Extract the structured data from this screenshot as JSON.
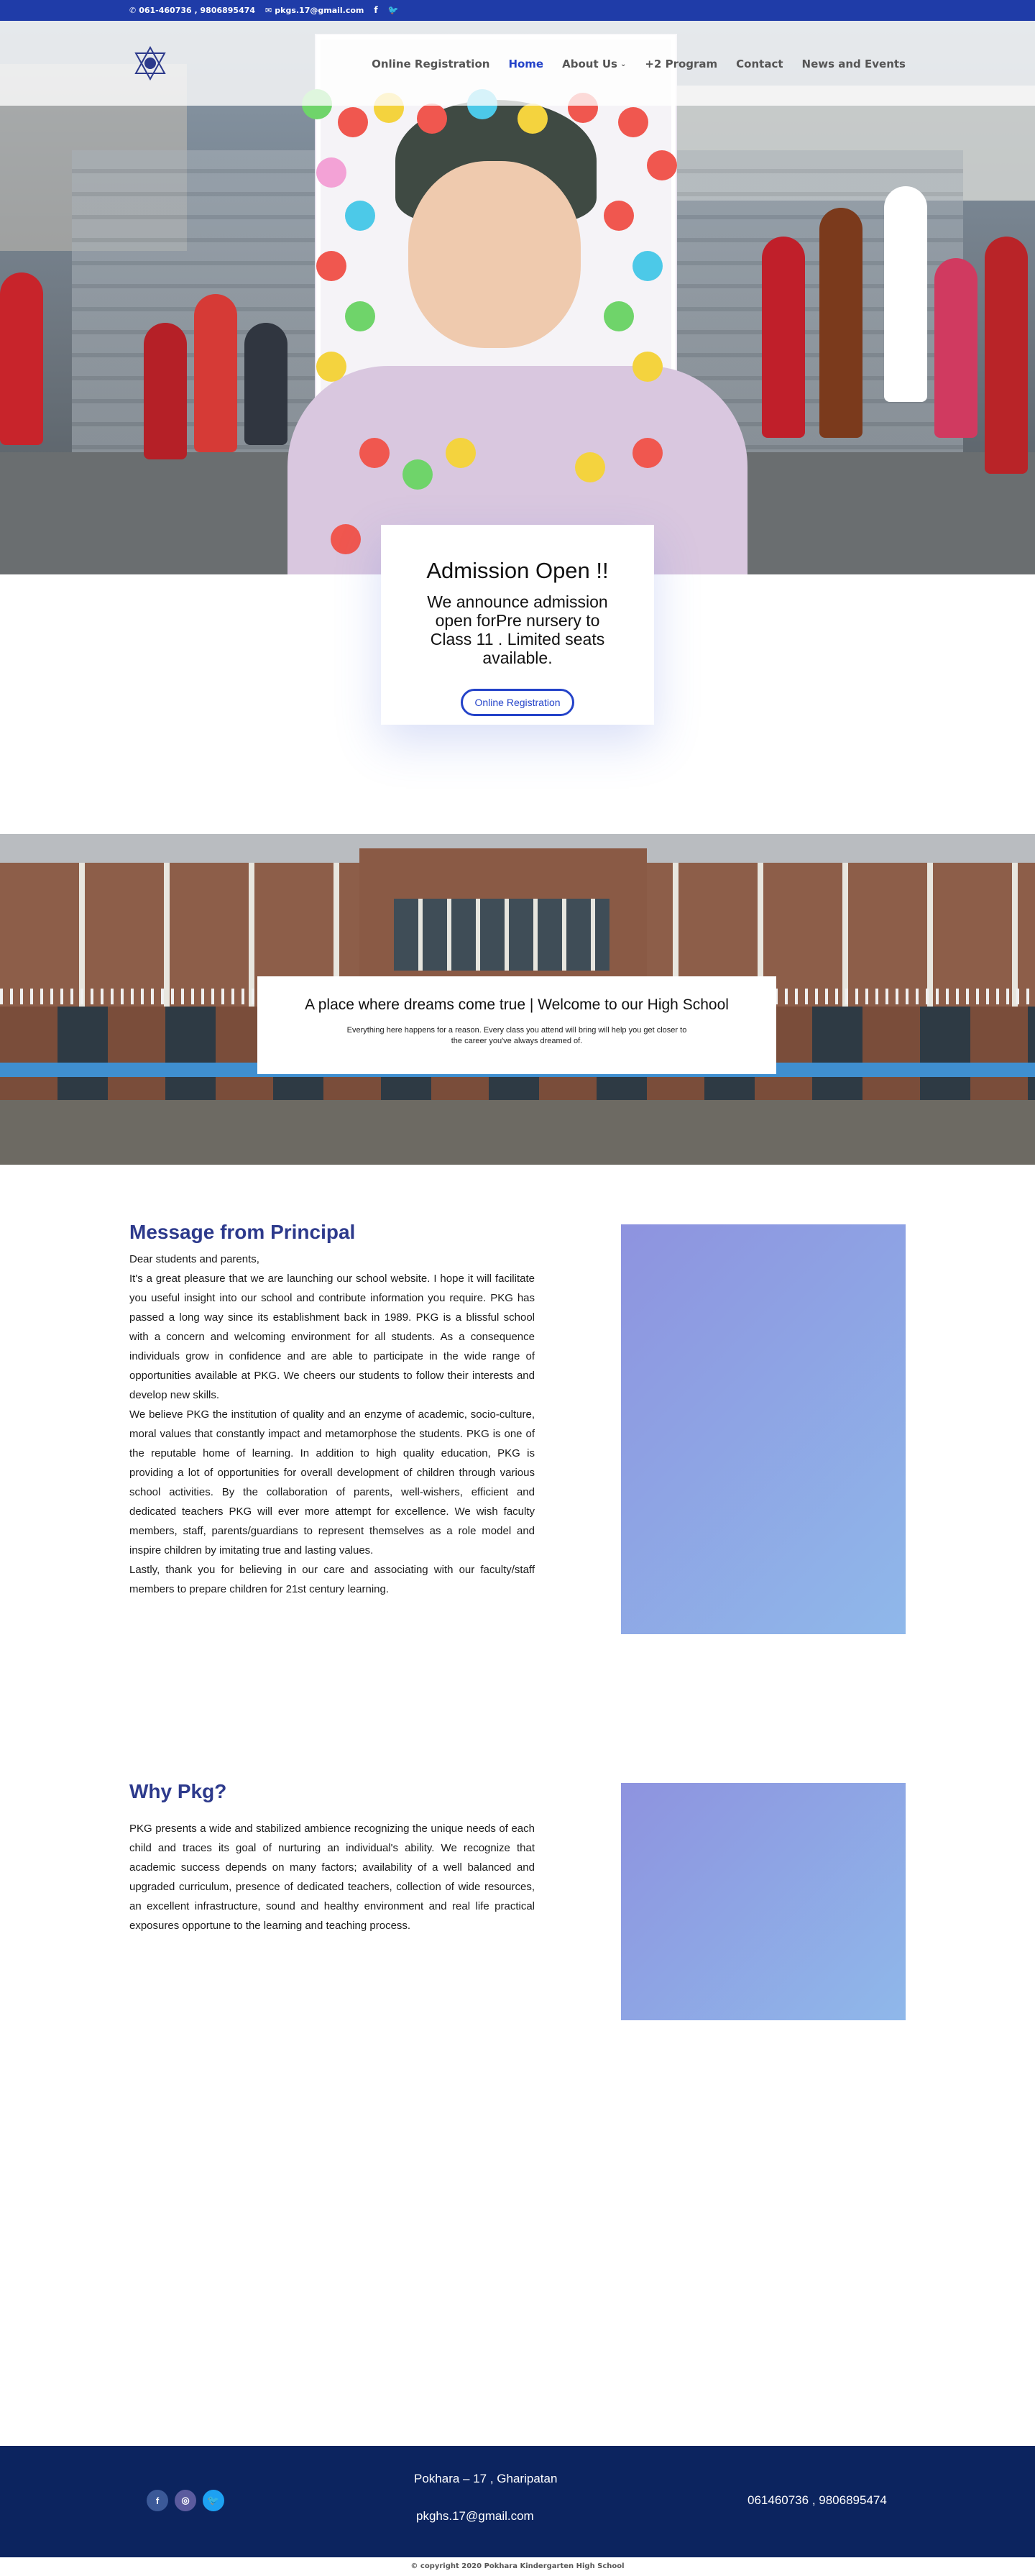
{
  "topbar": {
    "phone": "061-460736 , 9806895474",
    "email": "pkgs.17@gmail.com",
    "phone_icon": "phone-icon",
    "email_icon": "envelope-icon",
    "facebook_glyph": "f",
    "twitter_glyph": "🐦"
  },
  "nav": {
    "items": [
      {
        "label": "Online Registration"
      },
      {
        "label": "Home"
      },
      {
        "label": "About Us"
      },
      {
        "label": "+2 Program"
      },
      {
        "label": "Contact"
      },
      {
        "label": "News and Events"
      }
    ],
    "active_color": "#2443c9"
  },
  "admission": {
    "title": "Admission Open !!",
    "text": "We announce admission open forPre nursery to Class 11 . Limited seats available.",
    "button": "Online Registration"
  },
  "welcome": {
    "title": "A place where dreams come true | Welcome to our High School",
    "text": "Everything here happens for a reason. Every class you attend will bring will help you get closer to the career you've always dreamed of."
  },
  "principal": {
    "title": "Message from Principal",
    "paragraphs": [
      "Dear students and parents,",
      "It's a great pleasure that we are launching our school website. I hope it will facilitate you useful insight into our school and contribute information you require. PKG has passed a long way since its establishment back in 1989. PKG is a blissful school with a concern and welcoming environment for all students. As a consequence individuals grow in confidence and are able to participate in the wide range of opportunities available at PKG. We cheers our students to follow their interests and develop new skills.",
      "We believe PKG the institution of quality and an enzyme of academic, socio-culture, moral values that constantly impact and metamorphose the students. PKG is one of the reputable home of learning. In addition to high quality education, PKG is providing a  lot of opportunities for overall development of children through various school activities. By the collaboration of parents, well-wishers, efficient and dedicated teachers PKG will ever more attempt for excellence. We wish faculty members, staff, parents/guardians to represent themselves as a role model and inspire children by imitating true and lasting values.",
      "Lastly, thank you for believing in our care and associating with our faculty/staff members to prepare children for 21st century learning."
    ]
  },
  "why": {
    "title": "Why Pkg?",
    "text": "PKG presents a wide and stabilized ambience recognizing the unique needs of each child and traces its goal of nurturing an individual's ability. We recognize that academic success depends on many factors; availability of a well balanced and upgraded curriculum, presence of dedicated teachers, collection of wide resources, an excellent infrastructure, sound and healthy environment and real life practical exposures opportune to the learning and teaching process."
  },
  "footer": {
    "address": "Pokhara – 17 , Gharipatan",
    "email": "pkghs.17@gmail.com",
    "phone": "061460736 , 9806895474",
    "socials": [
      {
        "icon": "facebook-icon",
        "glyph": "f",
        "color": "#3b5998"
      },
      {
        "icon": "instagram-icon",
        "glyph": "◎",
        "color": "#5b5b9e"
      },
      {
        "icon": "twitter-icon",
        "glyph": "🐦",
        "color": "#1da1f2"
      }
    ],
    "background": "#0c245f"
  },
  "copyright": "© copyright 2020 Pokhara Kindergarten High School"
}
